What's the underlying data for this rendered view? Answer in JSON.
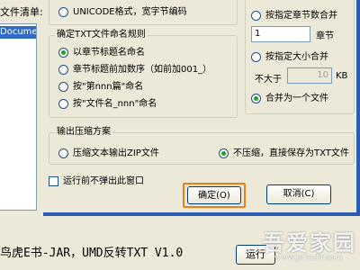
{
  "left": {
    "file_list_label": "文件清单:",
    "file_list_item": "Document"
  },
  "encoding_group": {
    "unicode_option": "UNICODE格式，宽字节编码"
  },
  "naming_group": {
    "title": "确定TXT文件命名规则",
    "options": [
      "以章节标题名命名",
      "章节标题前加数序（如前加001_）",
      "按\"第nnn篇\"命名",
      "按\"文件名_nnn\"命名"
    ]
  },
  "merge_group": {
    "by_chapter_label": "按指定章节数合并",
    "chapter_value": "1",
    "chapter_unit": "章节",
    "by_size_label": "按指定大小合并",
    "not_exceed_label": "不大于",
    "size_value": "10",
    "size_unit": "KB",
    "merge_one_label": "合并为一个文件"
  },
  "output_group": {
    "title": "输出压缩方案",
    "zip_option": "压缩文本输出ZIP文件",
    "no_zip_option": "不压缩，直接保存为TXT文件"
  },
  "checkbox_label": "运行前不弹出此窗口",
  "buttons": {
    "ok": "确定(O)",
    "cancel": "取消(C)",
    "run": "运行"
  },
  "bottom_title": "鸟虎E书-JAR，UMD反转TXT V1.0",
  "watermark": {
    "text": "吾爱家园",
    "url": "www.pcledir.com"
  },
  "colors": {
    "accent_orange": "#f07d1a",
    "dialog_border_blue": "#2a5db0"
  }
}
